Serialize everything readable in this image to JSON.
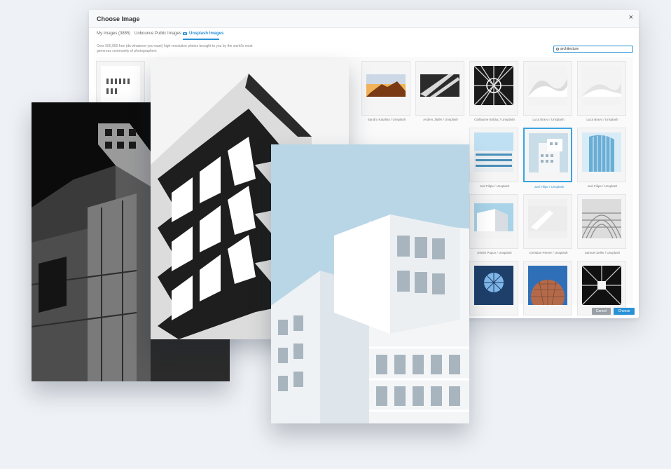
{
  "modal": {
    "title": "Choose Image",
    "close_glyph": "×",
    "tabs": [
      {
        "label": "My Images (3885)",
        "active": false
      },
      {
        "label": "Unbounce Public Images",
        "active": false
      },
      {
        "label": "Unsplash Images",
        "active": true,
        "icon": "camera-icon"
      }
    ],
    "description": "Over 500,000 free (do-whatever-you-want) high-resolution photos brought to you by the world's most generous community of photographers",
    "search": {
      "value": "architecture",
      "icon": "search-icon"
    },
    "tiles": [
      {
        "caption": "Sandro Katalina / Unsplash",
        "selected": false
      },
      {
        "caption": "Anders Jildén / Unsplash",
        "selected": false
      },
      {
        "caption": "Guillaume Bolduc / Unsplash",
        "selected": false
      },
      {
        "caption": "Luca Bravo / Unsplash",
        "selected": false
      },
      {
        "caption": "Luca Bravo / Unsplash",
        "selected": false
      },
      {
        "caption": "Joel Filipe / Unsplash",
        "selected": false
      },
      {
        "caption": "Joel Filipe / Unsplash",
        "selected": true
      },
      {
        "caption": "Joel Filipe / Unsplash",
        "selected": false
      },
      {
        "caption": "Dimitri Popov / Unsplash",
        "selected": false
      },
      {
        "caption": "Christian Perner / Unsplash",
        "selected": false
      },
      {
        "caption": "Samuel Zeller / Unsplash",
        "selected": false
      },
      {
        "caption": "",
        "selected": false
      },
      {
        "caption": "",
        "selected": false
      },
      {
        "caption": "",
        "selected": false
      }
    ],
    "cancel_label": "Cancel",
    "choose_label": "Choose"
  },
  "colors": {
    "accent": "#2a91d6",
    "cancel": "#9aa0a6",
    "background": "#eef1f5"
  }
}
